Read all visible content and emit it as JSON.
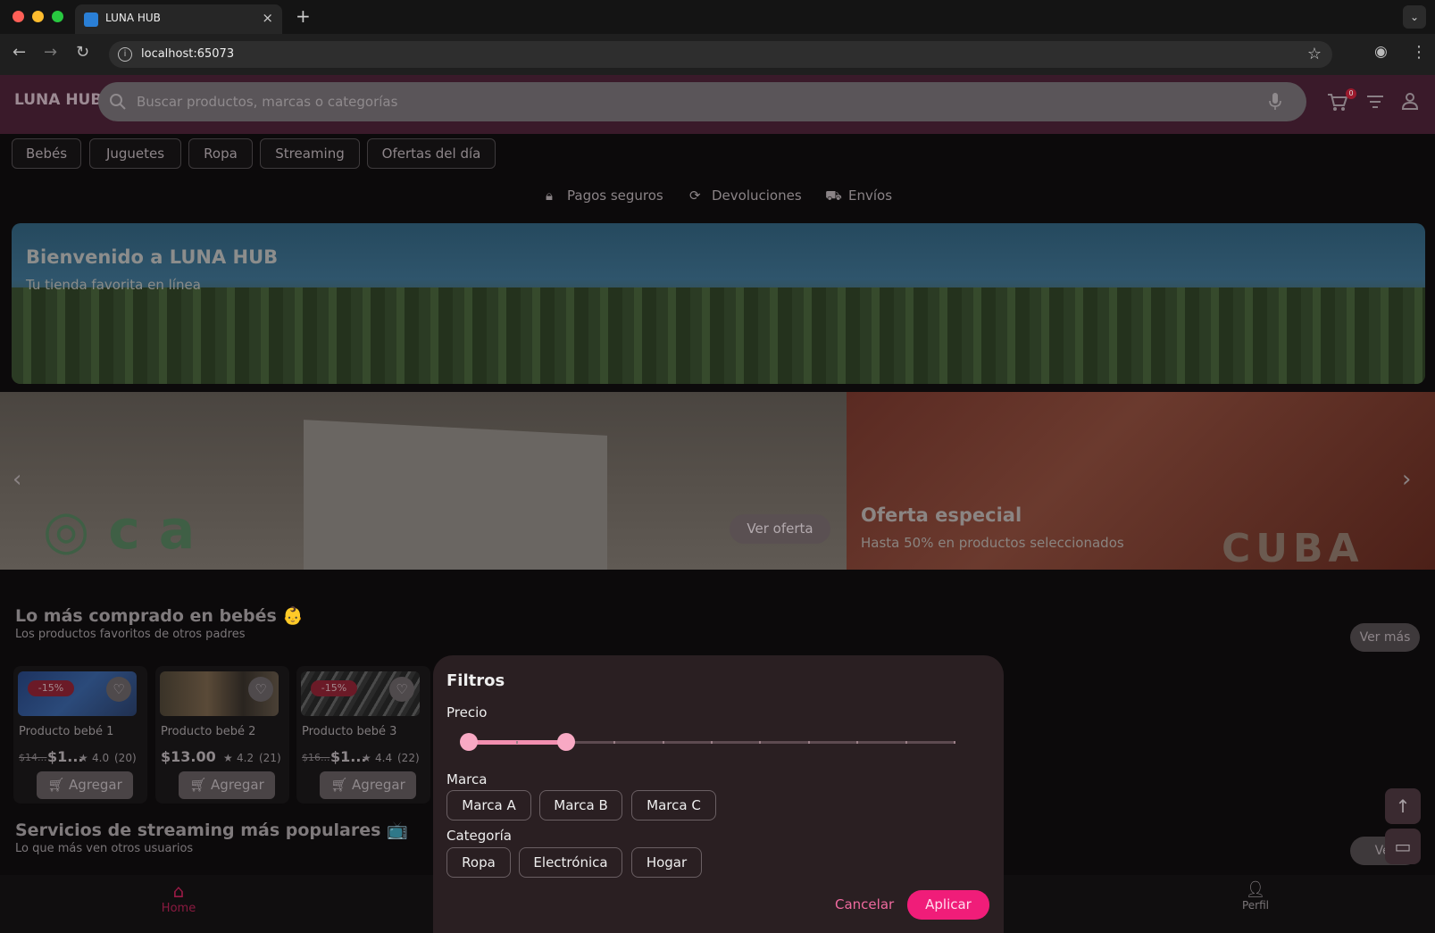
{
  "browser": {
    "tab_title": "LUNA HUB",
    "tab_close": "×",
    "new_tab": "+",
    "url": "localhost:65073"
  },
  "app": {
    "logo": "LUNA HUB",
    "search_placeholder": "Buscar productos, marcas o categorías",
    "cart_count": "0",
    "categories": [
      "Bebés",
      "Juguetes",
      "Ropa",
      "Streaming",
      "Ofertas del día"
    ],
    "features": [
      "Pagos seguros",
      "Devoluciones",
      "Envíos"
    ],
    "hero": {
      "title": "Bienvenido a LUNA HUB",
      "subtitle": "Tu tienda favorita en línea"
    },
    "slides": {
      "button": "Ver oferta",
      "offer_title": "Oferta especial",
      "offer_subtitle": "Hasta 50% en productos seleccionados",
      "active_index": 1,
      "count": 3
    },
    "section_baby": {
      "title": "Lo más comprado en bebés 👶",
      "subtitle": "Los productos favoritos de otros padres",
      "more": "Ver más"
    },
    "products": [
      {
        "name": "Producto bebé 1",
        "old_price": "$14...",
        "price": "$1...",
        "rating": "4.0",
        "reviews": "(20)",
        "discount": "-15%",
        "add": "Agregar"
      },
      {
        "name": "Producto bebé 2",
        "old_price": "",
        "price": "$13.00",
        "rating": "4.2",
        "reviews": "(21)",
        "discount": "",
        "add": "Agregar"
      },
      {
        "name": "Producto bebé 3",
        "old_price": "$16...",
        "price": "$1...",
        "rating": "4.4",
        "reviews": "(22)",
        "discount": "-15%",
        "add": "Agregar"
      }
    ],
    "section_streaming": {
      "title": "Servicios de streaming más populares 📺",
      "subtitle": "Lo que más ven otros usuarios",
      "more": "Ver"
    },
    "bottom_nav": {
      "home": "Home",
      "profile": "Perfil"
    }
  },
  "filters": {
    "title": "Filtros",
    "price_label": "Precio",
    "price_range": {
      "low_fraction": 0.0,
      "high_fraction": 0.2,
      "divisions": 10
    },
    "brand_label": "Marca",
    "brands": [
      "Marca A",
      "Marca B",
      "Marca C"
    ],
    "category_label": "Categoría",
    "categories": [
      "Ropa",
      "Electrónica",
      "Hogar"
    ],
    "cancel": "Cancelar",
    "apply": "Aplicar"
  },
  "colors": {
    "accent": "#f01d79",
    "appbar": "#3a1a2a",
    "slider": "#f8a9c4"
  }
}
